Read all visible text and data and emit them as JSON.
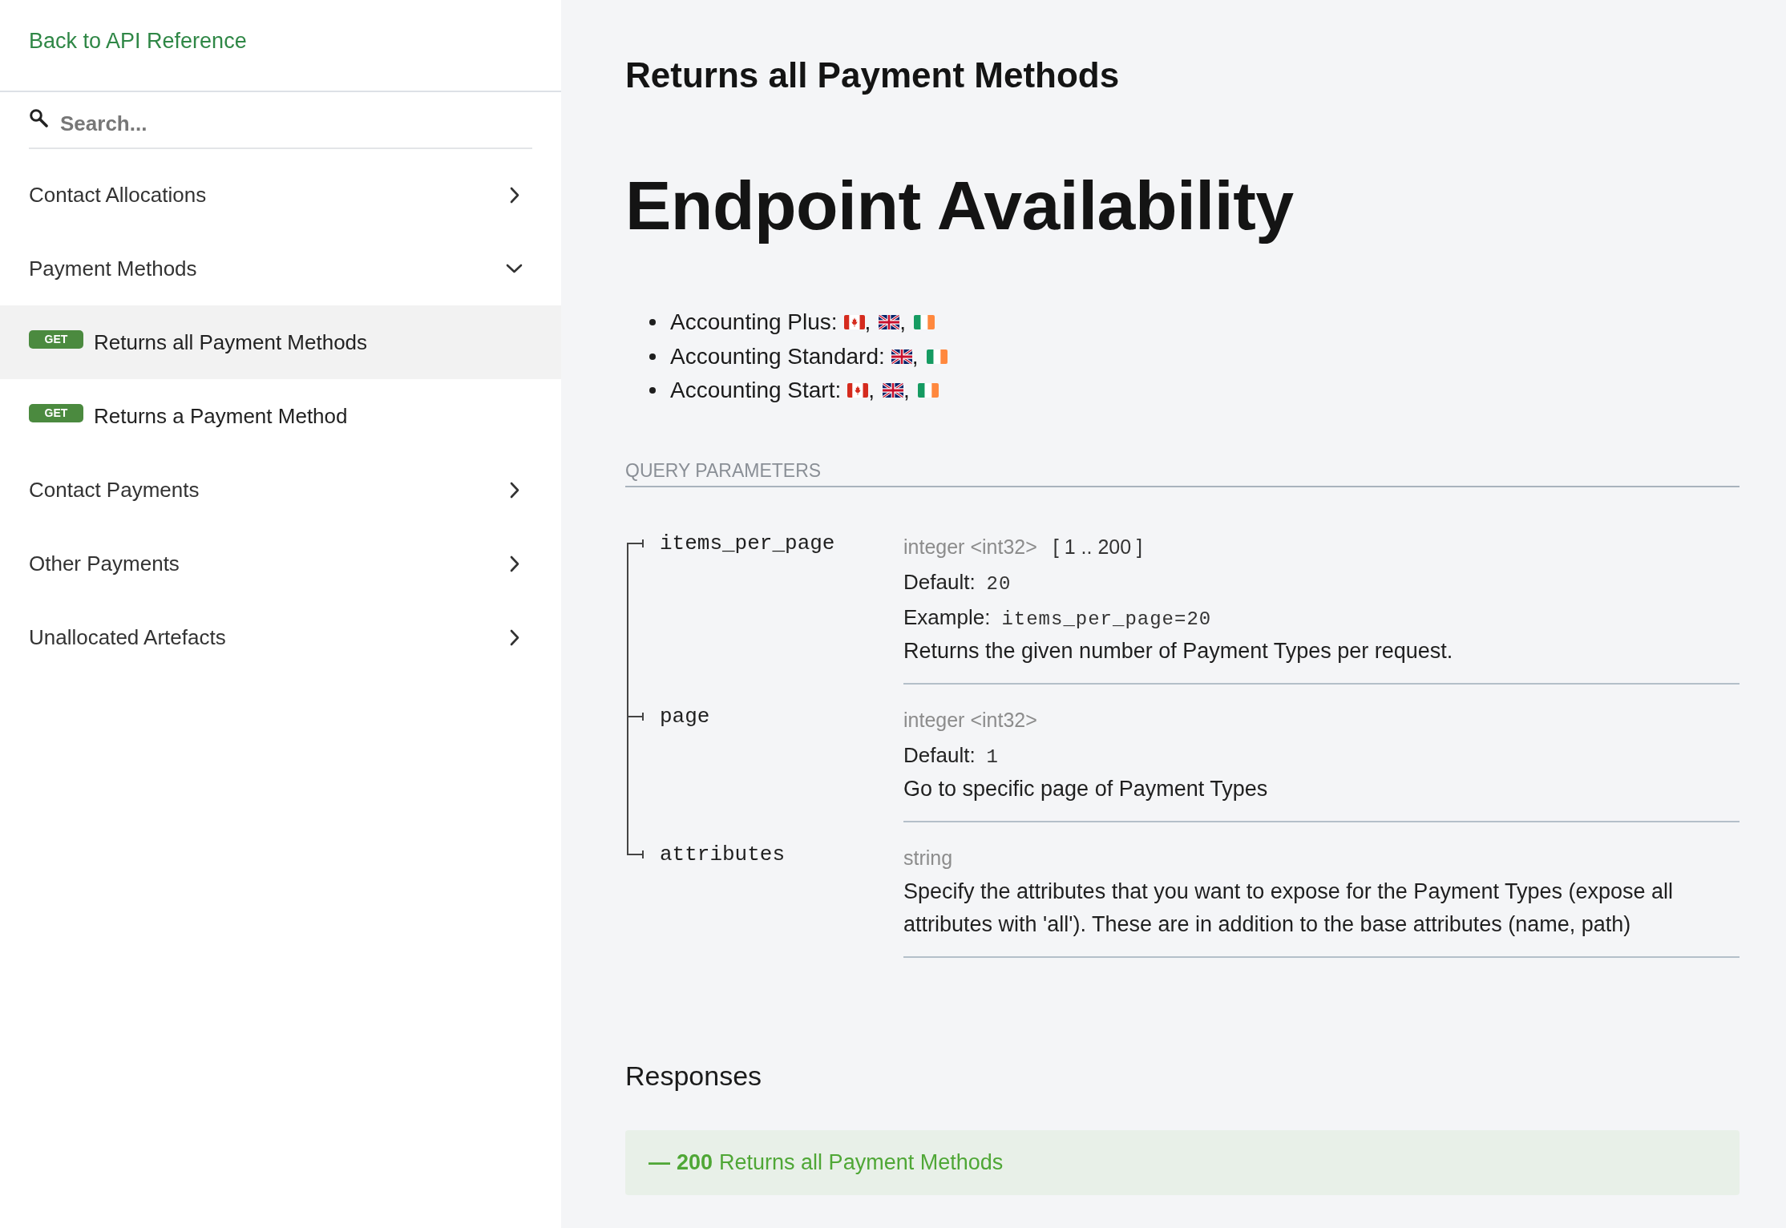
{
  "sidebar": {
    "back_link": "Back to API Reference",
    "search": {
      "placeholder": "Search..."
    },
    "items": [
      {
        "kind": "group",
        "label": "Contact Allocations",
        "expanded": false
      },
      {
        "kind": "group",
        "label": "Payment Methods",
        "expanded": true,
        "children": [
          {
            "kind": "operation",
            "method": "GET",
            "label": "Returns all Payment Methods",
            "selected": true
          },
          {
            "kind": "operation",
            "method": "GET",
            "label": "Returns a Payment Method",
            "selected": false
          }
        ]
      },
      {
        "kind": "group",
        "label": "Contact Payments",
        "expanded": false
      },
      {
        "kind": "group",
        "label": "Other Payments",
        "expanded": false
      },
      {
        "kind": "group",
        "label": "Unallocated Artefacts",
        "expanded": false
      }
    ]
  },
  "content": {
    "title": "Returns all Payment Methods",
    "availability": {
      "heading": "Endpoint Availability",
      "separator": ",",
      "items": [
        {
          "label": "Accounting Plus:",
          "regions": [
            {
              "kind": "canada"
            },
            {
              "kind": "uk"
            },
            {
              "kind": "ireland"
            }
          ]
        },
        {
          "label": "Accounting Standard:",
          "regions": [
            {
              "kind": "uk"
            },
            {
              "kind": "ireland"
            }
          ]
        },
        {
          "label": "Accounting Start:",
          "regions": [
            {
              "kind": "canada"
            },
            {
              "kind": "uk"
            },
            {
              "kind": "ireland"
            }
          ]
        }
      ]
    },
    "query_parameters": {
      "title": "QUERY PARAMETERS",
      "params": [
        {
          "name": "items_per_page",
          "type": "integer <int32>",
          "range": "[ 1 .. 200 ]",
          "default_label": "Default:",
          "default": "20",
          "example_label": "Example:",
          "example": "items_per_page=20",
          "description": "Returns the given number of Payment Types per request."
        },
        {
          "name": "page",
          "type": "integer <int32>",
          "default_label": "Default:",
          "default": "1",
          "description": "Go to specific page of Payment Types"
        },
        {
          "name": "attributes",
          "type": "string",
          "description": "Specify the attributes that you want to expose for the Payment Types (expose all attributes with 'all'). These are in addition to the base attributes (name, path)"
        }
      ]
    },
    "responses": {
      "title": "Responses",
      "items": [
        {
          "marker": "—",
          "code": "200",
          "label": "Returns all Payment Methods"
        }
      ]
    }
  }
}
